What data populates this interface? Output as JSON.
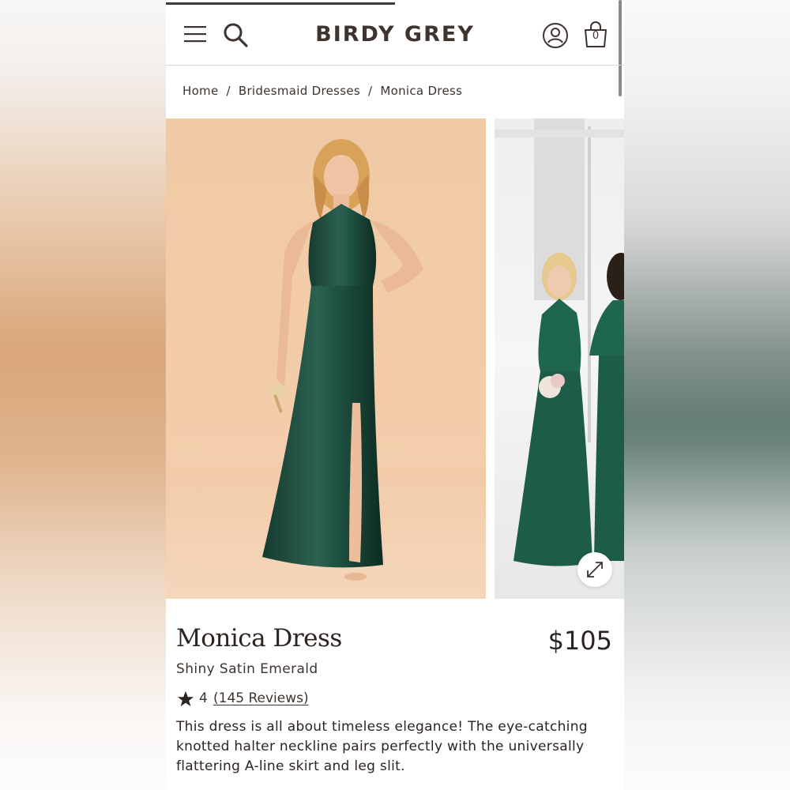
{
  "header": {
    "brand": "BIRDY GREY",
    "bag_count": "0"
  },
  "breadcrumb": {
    "items": [
      "Home",
      "Bridesmaid Dresses",
      "Monica Dress"
    ],
    "separator": "/"
  },
  "gallery": {
    "images": [
      "model-in-emerald-halter-dress",
      "bridesmaids-in-emerald-satin"
    ],
    "expand_icon": "expand-arrows-icon"
  },
  "product": {
    "name": "Monica Dress",
    "price": "$105",
    "variant": "Shiny Satin Emerald",
    "rating": "4",
    "reviews": "(145 Reviews)",
    "description": "This dress is all about timeless elegance! The eye-catching knotted halter neckline pairs perfectly with the universally flattering A-line skirt and leg slit."
  },
  "colors": {
    "text": "#2c2420",
    "dress": "#1f4a3c",
    "backdrop_main": "#f0c9a5"
  }
}
